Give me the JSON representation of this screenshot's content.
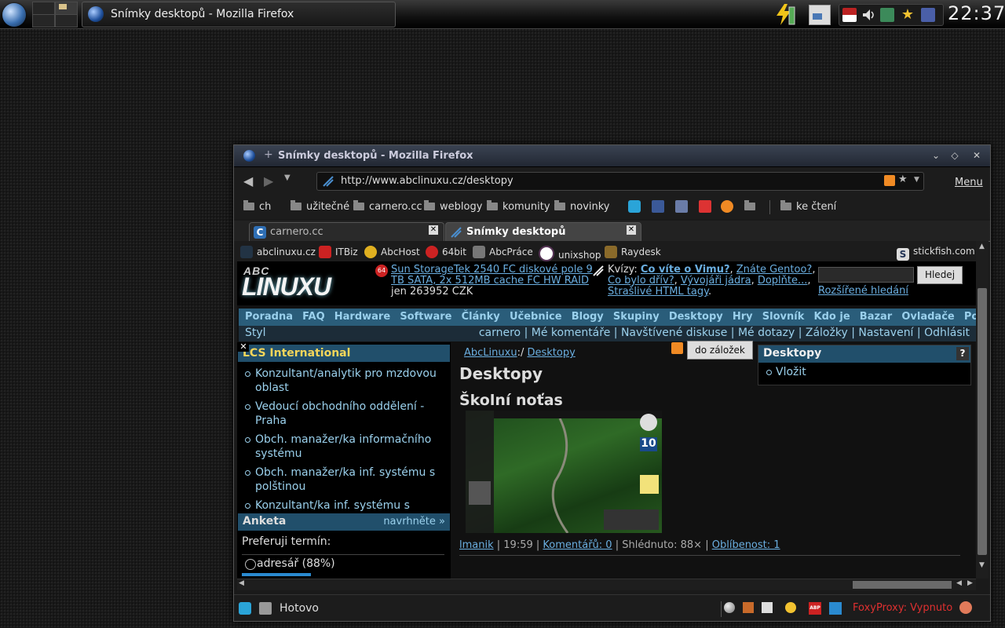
{
  "taskbar": {
    "window_title": "Snímky desktopů - Mozilla Firefox",
    "clock": "22:37",
    "tray_icons": [
      "us-flag-icon",
      "volume-icon",
      "network-icon",
      "star-icon",
      "notes-icon"
    ]
  },
  "browser": {
    "title": "Snímky desktopů - Mozilla Firefox",
    "url": "http://www.abclinuxu.cz/desktopy",
    "menu_label": "Menu",
    "bookmarks": [
      "ch",
      "užitečné",
      "carnero.cc",
      "weblogy",
      "komunity",
      "novinky",
      "ke čtení"
    ],
    "tabs": [
      {
        "label": "carnero.cc",
        "active": false
      },
      {
        "label": "Snímky desktopů",
        "active": true
      }
    ],
    "page_bookmarks": [
      "abclinuxu.cz",
      "ITBiz",
      "AbcHost",
      "64bit",
      "AbcPráce",
      "unixshop",
      "Raydesk"
    ],
    "stickfish": "stickfish.com",
    "status": "Hotovo",
    "foxyproxy": "FoxyProxy: Vypnuto"
  },
  "site": {
    "logo_abc": "ABC",
    "logo_linux": "LINUXU",
    "ad": {
      "link": "Sun StorageTek 2540 FC diskové pole 9 TB SATA, 2x 512MB cache FC HW RAID",
      "suffix": " jen 263952 CZK"
    },
    "kvizy": {
      "prefix": "Kvízy: ",
      "bold_link": "Co víte o Vimu?",
      "links": [
        "Znáte Gentoo?",
        "Co bylo dřív?",
        "Vývojáři jádra",
        "Doplňte...",
        "Strašlivé HTML tagy"
      ]
    },
    "search_button": "Hledej",
    "advanced_search": "Rozšířené hledání",
    "main_menu": [
      "Poradna",
      "FAQ",
      "Hardware",
      "Software",
      "Články",
      "Učebnice",
      "Blogy",
      "Skupiny",
      "Desktopy",
      "Hry",
      "Slovník",
      "Kdo je",
      "Bazar",
      "Ovladače",
      "Portál"
    ],
    "user_menu_left": "Styl",
    "user_menu": [
      "carnero",
      "Mé komentáře",
      "Navštívené diskuse",
      "Mé dotazy",
      "Záložky",
      "Nastavení",
      "Odhlásit"
    ],
    "jobs_box": {
      "title": "LCS International",
      "jobs": [
        "Konzultant/analytik pro mzdovou oblast",
        "Vedoucí obchodního oddělení - Praha",
        "Obch. manažer/ka informačního systému",
        "Obch. manažer/ka inf. systému s polštinou",
        "Konzultant/ka inf. systému s polštinou"
      ]
    },
    "poll": {
      "title": "Anketa",
      "suggest": "navrhněte »",
      "question": "Preferuji termín:",
      "option": "adresář (88%)"
    },
    "breadcrumb": {
      "home": "AbcLinuxu",
      "sep": ":/",
      "current": "Desktopy"
    },
    "bookmark_button": "do záložek",
    "page_heading": "Desktopy",
    "shot": {
      "title": "Školní noťas",
      "calendar_day": "10",
      "author": "lmanik",
      "time": "19:59",
      "comments": "Komentářů: 0",
      "views": "Shlédnuto: 88×",
      "popularity": "Oblíbenost: 1"
    },
    "right_box": {
      "title": "Desktopy",
      "help": "?",
      "item": "Vložit"
    }
  },
  "colors": {
    "menu_bg": "#2a5d7a",
    "link": "#6aaee0",
    "box_title": "#f5d65a"
  }
}
